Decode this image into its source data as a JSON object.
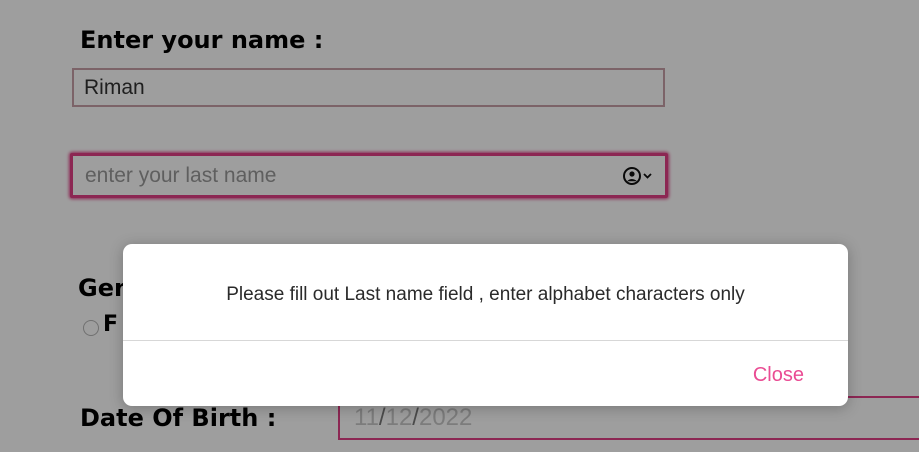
{
  "form": {
    "name_label": "Enter your name :",
    "first_name_value": "Riman",
    "last_name_placeholder": "enter your last name",
    "gender_label": "Gender",
    "gender_option_label": "F",
    "dob_label": "Date Of Birth :",
    "dob_month": "11",
    "dob_day": "12",
    "dob_year": "2022",
    "dob_separator": "/"
  },
  "dialog": {
    "message": "Please fill out Last name field , enter alphabet characters only",
    "close_label": "Close"
  },
  "colors": {
    "accent": "#e23f86",
    "close_text": "#ea4c93",
    "overlay": "rgba(0,0,0,0.38)"
  },
  "icons": {
    "autofill": "person-circle-icon",
    "dropdown": "chevron-down-icon"
  }
}
